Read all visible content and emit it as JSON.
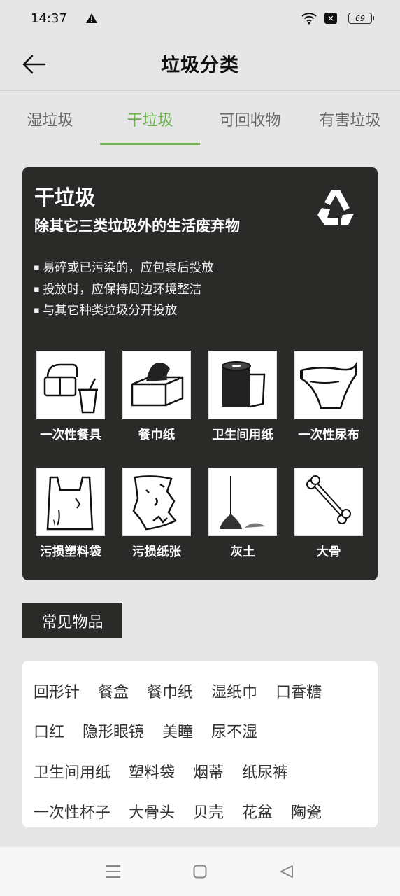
{
  "status_bar": {
    "time": "14:37",
    "battery": "69",
    "icons": [
      "warning-icon",
      "wifi-icon",
      "sim-x-icon",
      "battery-icon"
    ]
  },
  "header": {
    "title": "垃圾分类",
    "back_icon": "arrow-left-icon"
  },
  "tabs": [
    {
      "label": "湿垃圾",
      "active": false
    },
    {
      "label": "干垃圾",
      "active": true
    },
    {
      "label": "可回收物",
      "active": false
    },
    {
      "label": "有害垃圾",
      "active": false
    }
  ],
  "colors": {
    "accent": "#6bb34a",
    "card_bg": "#2a2a28",
    "page_bg": "#e6e6e6"
  },
  "card": {
    "title": "干垃圾",
    "subtitle": "除其它三类垃圾外的生活废弃物",
    "icon": "recycle-icon",
    "tips": [
      "易碎或已污染的，应包裹后投放",
      "投放时，应保持周边环境整洁",
      "与其它种类垃圾分开投放"
    ],
    "items": [
      {
        "label": "一次性餐具",
        "icon": "disposable-tableware-icon"
      },
      {
        "label": "餐巾纸",
        "icon": "tissue-box-icon"
      },
      {
        "label": "卫生间用纸",
        "icon": "toilet-paper-icon"
      },
      {
        "label": "一次性尿布",
        "icon": "diaper-icon"
      },
      {
        "label": "污损塑料袋",
        "icon": "plastic-bag-icon"
      },
      {
        "label": "污损纸张",
        "icon": "torn-paper-icon"
      },
      {
        "label": "灰土",
        "icon": "broom-dust-icon"
      },
      {
        "label": "大骨",
        "icon": "bone-icon"
      }
    ]
  },
  "common": {
    "title": "常见物品",
    "rows": [
      [
        "回形针",
        "餐盒",
        "餐巾纸",
        "湿纸巾",
        "口香糖"
      ],
      [
        "口红",
        "隐形眼镜",
        "美瞳",
        "尿不湿"
      ],
      [
        "卫生间用纸",
        "塑料袋",
        "烟蒂",
        "纸尿裤"
      ],
      [
        "一次性杯子",
        "大骨头",
        "贝壳",
        "花盆",
        "陶瓷"
      ]
    ]
  },
  "nav_bar": {
    "icons": [
      "menu-icon",
      "home-square-icon",
      "back-triangle-icon"
    ]
  }
}
